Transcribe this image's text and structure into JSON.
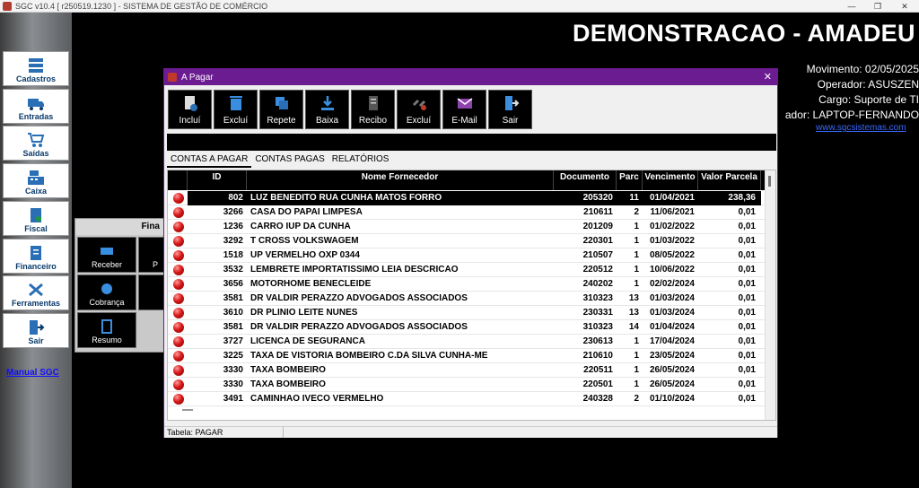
{
  "window": {
    "title": "SGC v10.4 [ r250519.1230 ] - SISTEMA DE GESTÃO DE COMÉRCIO",
    "min": "—",
    "max": "❐",
    "close": "✕"
  },
  "sidebar": {
    "items": [
      {
        "label": "Cadastros",
        "icon": "database-icon"
      },
      {
        "label": "Entradas",
        "icon": "truck-icon"
      },
      {
        "label": "Saídas",
        "icon": "cart-icon"
      },
      {
        "label": "Caixa",
        "icon": "cash-register-icon"
      },
      {
        "label": "Fiscal",
        "icon": "fiscal-doc-icon"
      },
      {
        "label": "Financeiro",
        "icon": "finance-doc-icon"
      },
      {
        "label": "Ferramentas",
        "icon": "tools-icon"
      },
      {
        "label": "Sair",
        "icon": "exit-door-icon"
      }
    ],
    "manual": "Manual SGC"
  },
  "header": {
    "company": "DEMONSTRACAO - AMADEU",
    "movimento": "Movimento: 02/05/2025",
    "operador": "Operador: ASUSZEN",
    "cargo": "Cargo: Suporte de TI",
    "computador": "ador: LAPTOP-FERNANDO",
    "site": "www.sgcsistemas.com"
  },
  "fin_panel": {
    "title": "Fina",
    "buttons": [
      "Receber",
      "P",
      "Cobrança",
      "",
      "Resumo"
    ]
  },
  "dialog": {
    "title": "A Pagar",
    "close": "✕",
    "toolbar": [
      "Incluí",
      "Excluí",
      "Repete",
      "Baixa",
      "Recibo",
      "Excluí",
      "E-Mail",
      "Sair"
    ],
    "tabs": [
      "CONTAS A PAGAR",
      "CONTAS PAGAS",
      "RELATÓRIOS"
    ],
    "columns": {
      "id": "ID",
      "nome": "Nome Fornecedor",
      "documento": "Documento",
      "parc": "Parc",
      "vencimento": "Vencimento",
      "valor": "Valor Parcela"
    },
    "rows": [
      {
        "id": "802",
        "nome": "LUZ BENEDITO RUA CUNHA MATOS FORRO",
        "doc": "205320",
        "parc": "11",
        "venc": "01/04/2021",
        "valor": "238,36"
      },
      {
        "id": "3266",
        "nome": "CASA DO PAPAI LIMPESA",
        "doc": "210611",
        "parc": "2",
        "venc": "11/06/2021",
        "valor": "0,01"
      },
      {
        "id": "1236",
        "nome": "CARRO IUP DA CUNHA",
        "doc": "201209",
        "parc": "1",
        "venc": "01/02/2022",
        "valor": "0,01"
      },
      {
        "id": "3292",
        "nome": "T CROSS VOLKSWAGEM",
        "doc": "220301",
        "parc": "1",
        "venc": "01/03/2022",
        "valor": "0,01"
      },
      {
        "id": "1518",
        "nome": "UP VERMELHO OXP 0344",
        "doc": "210507",
        "parc": "1",
        "venc": "08/05/2022",
        "valor": "0,01"
      },
      {
        "id": "3532",
        "nome": "LEMBRETE IMPORTATISSIMO LEIA DESCRICAO",
        "doc": "220512",
        "parc": "1",
        "venc": "10/06/2022",
        "valor": "0,01"
      },
      {
        "id": "3656",
        "nome": "MOTORHOME BENECLEIDE",
        "doc": "240202",
        "parc": "1",
        "venc": "02/02/2024",
        "valor": "0,01"
      },
      {
        "id": "3581",
        "nome": "DR VALDIR PERAZZO ADVOGADOS ASSOCIADOS",
        "doc": "310323",
        "parc": "13",
        "venc": "01/03/2024",
        "valor": "0,01"
      },
      {
        "id": "3610",
        "nome": "DR PLINIO LEITE NUNES",
        "doc": "230331",
        "parc": "13",
        "venc": "01/03/2024",
        "valor": "0,01"
      },
      {
        "id": "3581",
        "nome": "DR VALDIR PERAZZO ADVOGADOS ASSOCIADOS",
        "doc": "310323",
        "parc": "14",
        "venc": "01/04/2024",
        "valor": "0,01"
      },
      {
        "id": "3727",
        "nome": "LICENCA DE SEGURANCA",
        "doc": "230613",
        "parc": "1",
        "venc": "17/04/2024",
        "valor": "0,01"
      },
      {
        "id": "3225",
        "nome": "TAXA DE VISTORIA BOMBEIRO C.DA SILVA CUNHA-ME",
        "doc": "210610",
        "parc": "1",
        "venc": "23/05/2024",
        "valor": "0,01"
      },
      {
        "id": "3330",
        "nome": "TAXA BOMBEIRO",
        "doc": "220511",
        "parc": "1",
        "venc": "26/05/2024",
        "valor": "0,01"
      },
      {
        "id": "3330",
        "nome": "TAXA BOMBEIRO",
        "doc": "220501",
        "parc": "1",
        "venc": "26/05/2024",
        "valor": "0,01"
      },
      {
        "id": "3491",
        "nome": "CAMINHAO IVECO VERMELHO",
        "doc": "240328",
        "parc": "2",
        "venc": "01/10/2024",
        "valor": "0,01"
      }
    ],
    "status": "Tabela: PAGAR"
  },
  "colors": {
    "purple": "#6a1c90",
    "accent_blue": "#1010ff",
    "row_dot": "#d81818"
  }
}
